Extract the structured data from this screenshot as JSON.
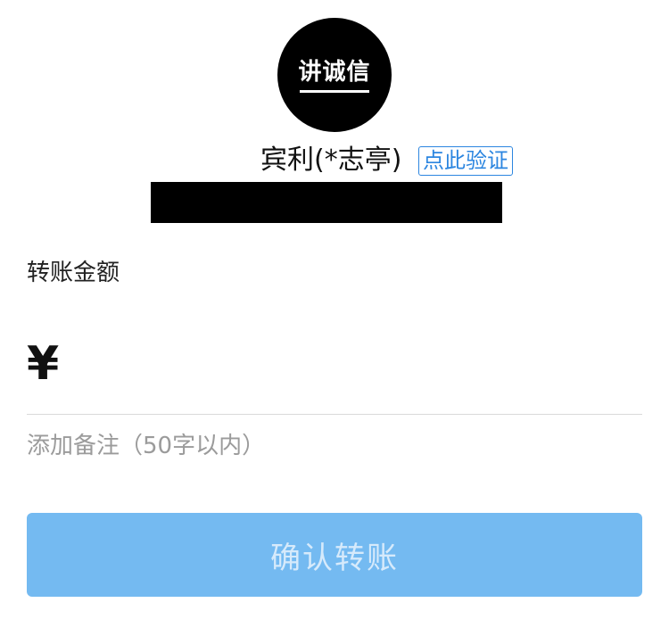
{
  "payee": {
    "avatar_text": "讲诚信",
    "name": "宾利(*志亭)",
    "verify_label": "点此验证"
  },
  "amount": {
    "label": "转账金额",
    "currency_symbol": "¥",
    "value": ""
  },
  "remark": {
    "label": "添加备注（50字以内）"
  },
  "confirm": {
    "label": "确认转账"
  },
  "colors": {
    "accent": "#2c86e0",
    "button_bg": "#74baf1",
    "button_text": "#d6eafb",
    "muted_text": "#9b9b9b"
  }
}
